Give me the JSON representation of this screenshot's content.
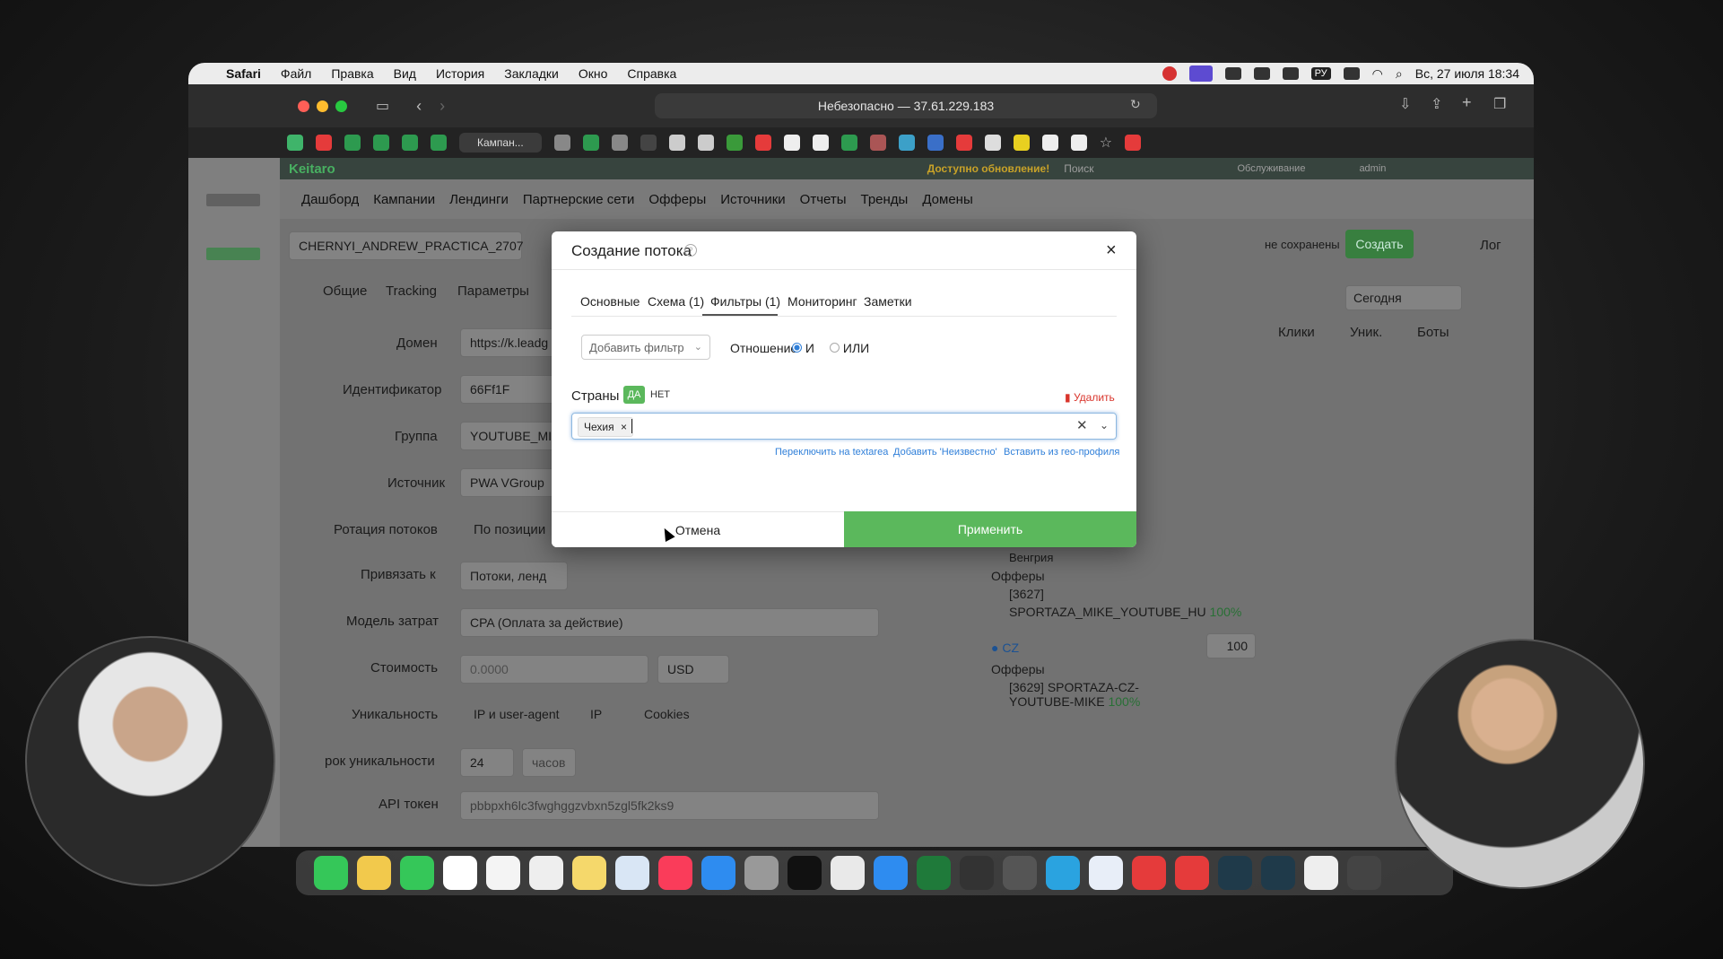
{
  "menubar": {
    "app": "Safari",
    "items": [
      "Файл",
      "Правка",
      "Вид",
      "История",
      "Закладки",
      "Окно",
      "Справка"
    ],
    "lang": "РУ",
    "datetime": "Вс, 27 июля  18:34"
  },
  "browser": {
    "address": "Небезопасно — 37.61.229.183",
    "active_tab": "Кампан..."
  },
  "keitaro": {
    "logo": "Keitaro",
    "update_notice": "Доступно обновление!",
    "search_placeholder": "Поиск",
    "service": "Обслуживание",
    "user": "admin"
  },
  "nav": [
    "Дашборд",
    "Кампании",
    "Лендинги",
    "Партнерские сети",
    "Офферы",
    "Источники",
    "Отчеты",
    "Тренды",
    "Домены"
  ],
  "campaign": {
    "name": "CHERNYI_ANDREW_PRACTICA_2707",
    "unsaved": "не сохранены",
    "create_button": "Создать",
    "log": "Лог",
    "tabs": [
      "Общие",
      "Tracking",
      "Параметры"
    ],
    "fields": [
      {
        "label": "Домен",
        "value": "https://k.leadg"
      },
      {
        "label": "Идентификатор",
        "value": "66Ff1F"
      },
      {
        "label": "Группа",
        "value": "YOUTUBE_MIK"
      },
      {
        "label": "Источник",
        "value": "PWA VGroup"
      },
      {
        "label": "Ротация потоков",
        "value": "По позиции"
      },
      {
        "label": "Привязать к",
        "value": "Потоки, ленд"
      },
      {
        "label": "Модель затрат",
        "value": "CPA (Оплата за действие)"
      },
      {
        "label": "Стоимость",
        "value": "0.0000"
      },
      {
        "label": "Уникальность",
        "value": "IP и user-agent"
      },
      {
        "label": "рок уникальности",
        "value": "24"
      },
      {
        "label": "API токен",
        "value": "pbbpxh6lc3fwghggzvbxn5zgl5fk2ks9"
      }
    ],
    "currency": "USD",
    "uniq_options": [
      "IP и user-agent",
      "IP",
      "Cookies"
    ],
    "hours_label": "часов"
  },
  "right_panel": {
    "period": "Сегодня",
    "columns": [
      "Клики",
      "Уник.",
      "Боты"
    ],
    "partial_text": "Венгрия",
    "offers_label": "Офферы",
    "offer1_id": "[3627]",
    "offer1_name": "SPORTAZA_MIKE_YOUTUBE_HU",
    "offer1_pct": "100%",
    "geo2": "CZ",
    "geo2_weight": "100",
    "offer2_name": "[3629] SPORTAZA-CZ-YOUTUBE-MIKE",
    "offer2_pct": "100%"
  },
  "modal": {
    "title": "Создание потока",
    "tabs": [
      "Основные",
      "Схема (1)",
      "Фильтры (1)",
      "Мониторинг",
      "Заметки"
    ],
    "add_filter_placeholder": "Добавить фильтр",
    "relation_label": "Отношение",
    "relation_and": "И",
    "relation_or": "ИЛИ",
    "filter_name": "Страны",
    "yes": "ДА",
    "no": "НЕТ",
    "delete": "Удалить",
    "selected_tag": "Чехия",
    "link_textarea": "Переключить на textarea",
    "link_unknown": "Добавить 'Неизвестно'",
    "link_geo": "Вставить из гео-профиля",
    "cancel": "Отмена",
    "apply": "Применить"
  },
  "colors": {
    "accent_green": "#5bb85c",
    "link_blue": "#2f7fd9",
    "danger": "#d9342b"
  }
}
